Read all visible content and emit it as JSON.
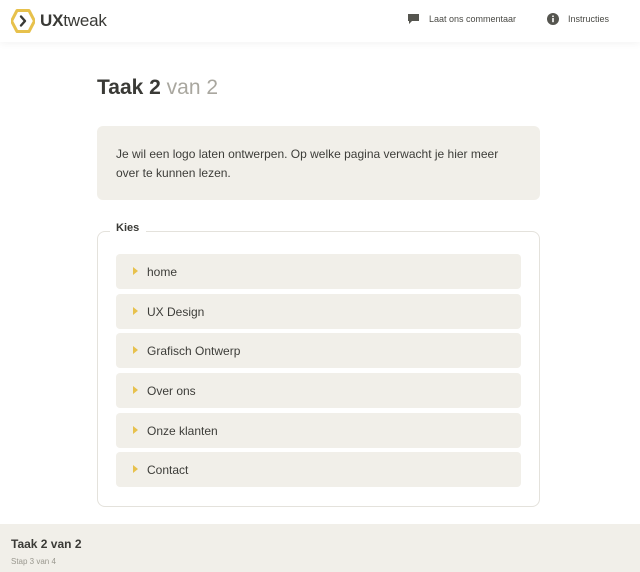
{
  "header": {
    "brand_bold": "UX",
    "brand_rest": "tweak",
    "comment_label": "Laat ons commentaar",
    "instructions_label": "Instructies"
  },
  "task": {
    "title_strong": "Taak 2",
    "title_light": "van 2",
    "description": "Je wil een logo laten ontwerpen. Op welke pagina verwacht je hier meer over te kunnen lezen."
  },
  "choices": {
    "legend": "Kies",
    "options": [
      {
        "label": "home"
      },
      {
        "label": "UX Design"
      },
      {
        "label": "Grafisch Ontwerp"
      },
      {
        "label": "Over ons"
      },
      {
        "label": "Onze klanten"
      },
      {
        "label": "Contact"
      }
    ]
  },
  "footer": {
    "title": "Taak 2 van 2",
    "step": "Stap 3 van 4"
  },
  "colors": {
    "accent": "#e7c14c",
    "panel": "#f1efe9",
    "text": "#3a3a36"
  },
  "icons": {
    "logo": "uxtweak-hexagon-logo",
    "comment": "speech-bubble-icon",
    "instructions": "info-icon",
    "option": "triangle-right-icon"
  }
}
